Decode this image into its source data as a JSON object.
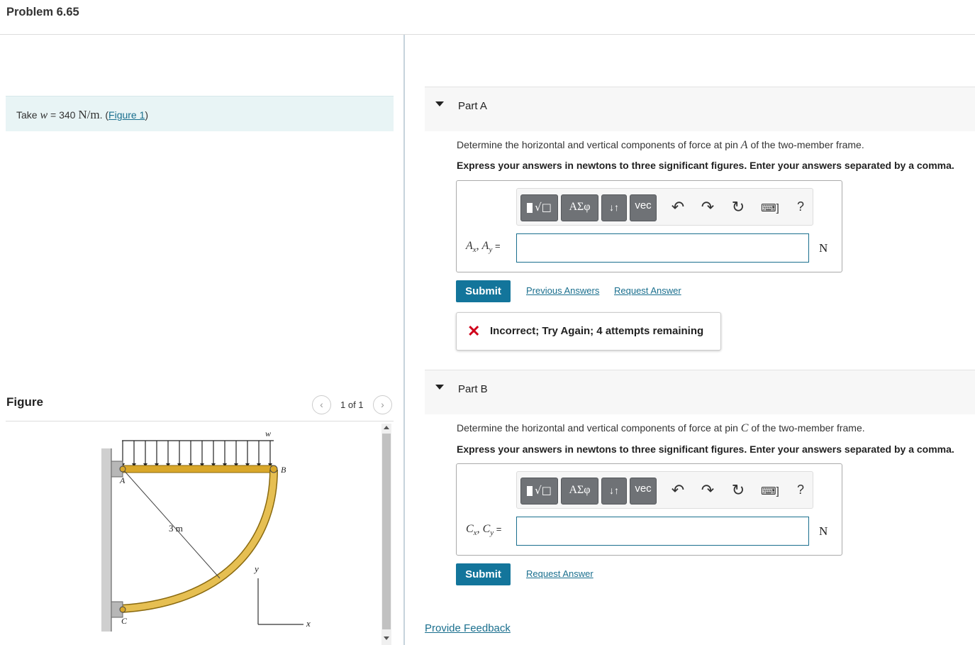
{
  "header": {
    "title": "Problem 6.65"
  },
  "info": {
    "take": "Take ",
    "var": "w",
    "eq": " = 340 ",
    "unit": "N/m",
    "period": ". (",
    "figure_link": "Figure 1",
    "close": ")"
  },
  "figure": {
    "title": "Figure",
    "pager": "1 of 1",
    "labels": {
      "w": "w",
      "B": "B",
      "A": "A",
      "C": "C",
      "dim": "3 m",
      "y": "y",
      "x": "x"
    }
  },
  "part_a": {
    "label": "Part A",
    "question_pre": "Determine the horizontal and vertical components of force at pin ",
    "question_var": "A",
    "question_post": " of the two-member frame.",
    "instruction": "Express your answers in newtons to three significant figures. Enter your answers separated by a comma.",
    "answer_label": "Ax, Ay =",
    "answer_value": "",
    "unit": "N",
    "submit": "Submit",
    "previous": "Previous Answers",
    "request": "Request Answer",
    "feedback": "Incorrect; Try Again; 4 attempts remaining"
  },
  "part_b": {
    "label": "Part B",
    "question_pre": "Determine the horizontal and vertical components of force at pin ",
    "question_var": "C",
    "question_post": " of the two-member frame.",
    "instruction": "Express your answers in newtons to three significant figures. Enter your answers separated by a comma.",
    "answer_label": "Cx, Cy =",
    "answer_value": "",
    "unit": "N",
    "submit": "Submit",
    "request": "Request Answer"
  },
  "toolbar": {
    "greek": "ΑΣφ",
    "updown": "↓↑",
    "vec": "vec",
    "help": "?"
  },
  "footer": {
    "feedback": "Provide Feedback"
  },
  "icons": [
    "template-icon",
    "undo-icon",
    "redo-icon",
    "reset-icon",
    "keyboard-icon",
    "help-icon",
    "error-x-icon"
  ],
  "colors": {
    "accent": "#13759b",
    "link": "#1a6f8e",
    "error": "#d0021b",
    "info_bg": "#e8f4f5",
    "beam": "#d9a72a"
  }
}
